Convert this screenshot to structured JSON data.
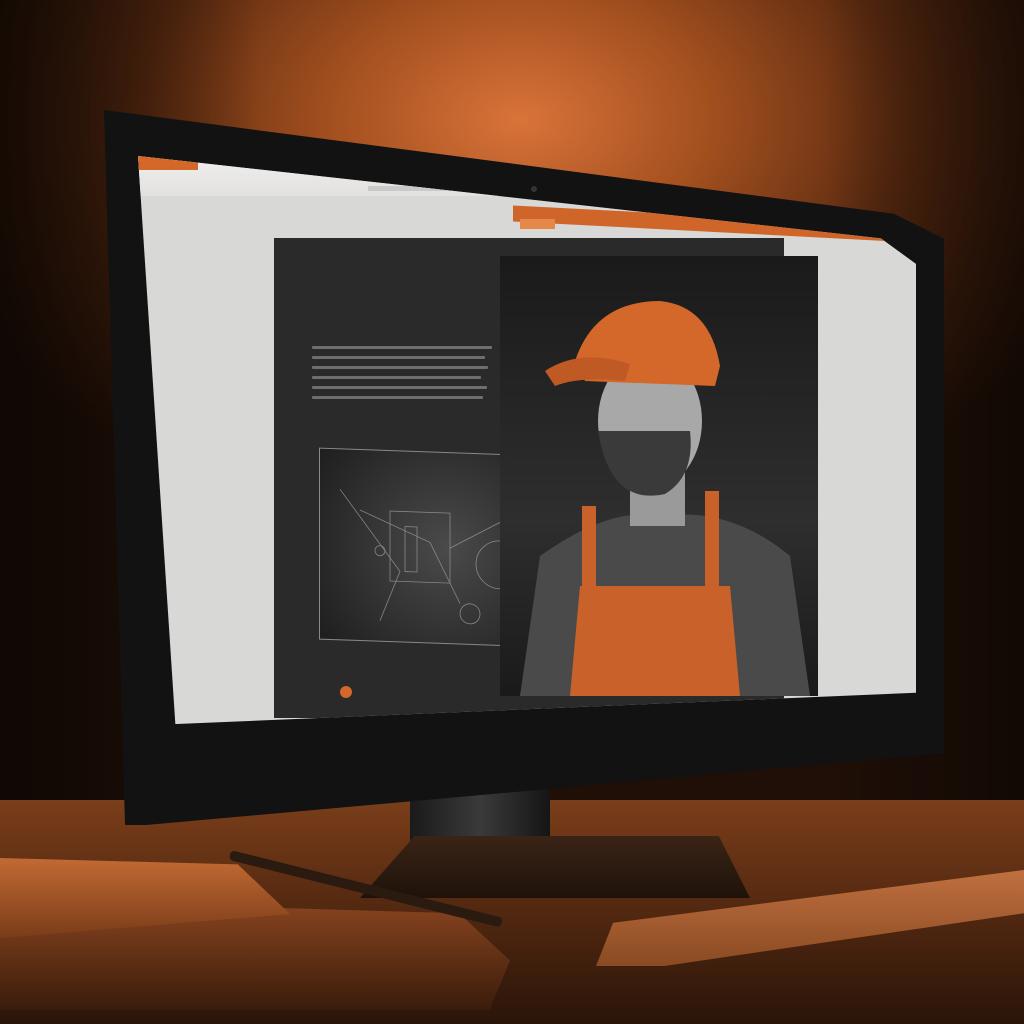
{
  "scene": {
    "description_hidden": "",
    "accent": "#d4672a",
    "screen_bg": "#d8d8d6",
    "panel_bg": "#2a2a2a"
  },
  "browser": {
    "tab_label": "",
    "nav_button_label": "",
    "address": ""
  },
  "page": {
    "eyebrow": "",
    "headline": "",
    "subline": "",
    "cta": ""
  },
  "bezel": {
    "logo": ""
  },
  "icons": {
    "cta_icon": "circle-icon",
    "camera": "camera-icon"
  }
}
